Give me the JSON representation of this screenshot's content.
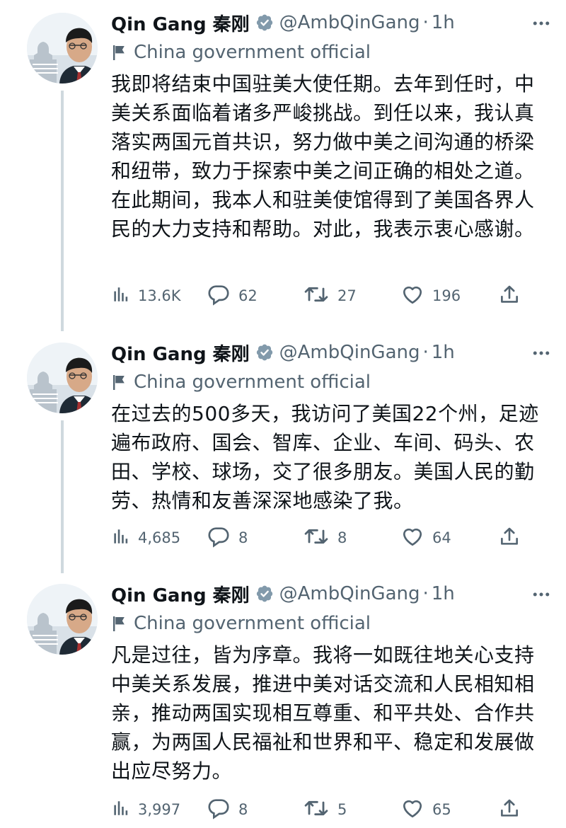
{
  "tweets": [
    {
      "author": {
        "name": "Qin Gang 秦刚",
        "handle": "@AmbQinGang"
      },
      "separator": "·",
      "time": "1h",
      "label": "China government official",
      "text": "我即将结束中国驻美大使任期。去年到任时，中美关系面临着诸多严峻挑战。到任以来，我认真落实两国元首共识，努力做中美之间沟通的桥梁和纽带，致力于探索中美之间正确的相处之道。在此期间，我本人和驻美使馆得到了美国各界人民的大力支持和帮助。对此，我表示衷心感谢。",
      "stats": {
        "views": "13.6K",
        "replies": "62",
        "retweets": "27",
        "likes": "196"
      }
    },
    {
      "author": {
        "name": "Qin Gang 秦刚",
        "handle": "@AmbQinGang"
      },
      "separator": "·",
      "time": "1h",
      "label": "China government official",
      "text": "在过去的500多天，我访问了美国22个州，足迹遍布政府、国会、智库、企业、车间、码头、农田、学校、球场，交了很多朋友。美国人民的勤劳、热情和友善深深地感染了我。",
      "stats": {
        "views": "4,685",
        "replies": "8",
        "retweets": "8",
        "likes": "64"
      }
    },
    {
      "author": {
        "name": "Qin Gang 秦刚",
        "handle": "@AmbQinGang"
      },
      "separator": "·",
      "time": "1h",
      "label": "China government official",
      "text": "凡是过往，皆为序章。我将一如既往地关心支持中美关系发展，推进中美对话交流和人民相知相亲，推动两国实现相互尊重、和平共处、合作共赢，为两国人民福祉和世界和平、稳定和发展做出应尽努力。",
      "stats": {
        "views": "3,997",
        "replies": "8",
        "retweets": "5",
        "likes": "65"
      }
    }
  ],
  "icons": {
    "views": "views-icon",
    "reply": "reply-icon",
    "retweet": "retweet-icon",
    "like": "like-icon",
    "share": "share-icon",
    "verified": "verified-badge-icon",
    "label": "flag-icon",
    "more": "more-icon"
  },
  "colors": {
    "text": "#0f1419",
    "secondary": "#536471",
    "thread_line": "#cfd9de",
    "background": "#ffffff"
  }
}
